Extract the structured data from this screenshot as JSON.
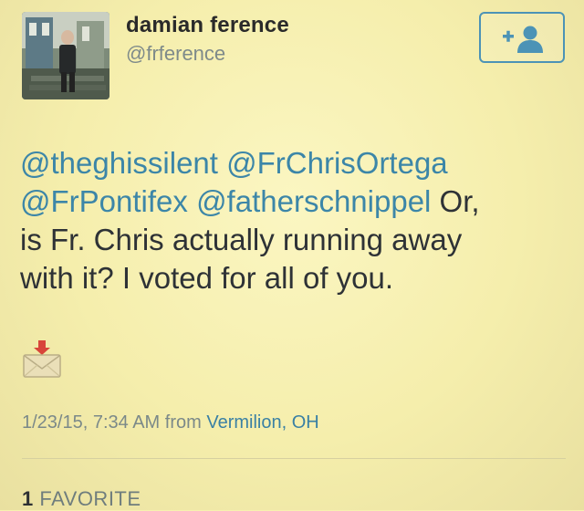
{
  "user": {
    "display_name": "damian ference",
    "handle": "@frference"
  },
  "follow_button": {
    "icon": "add-person-icon",
    "color": "#4c93b6"
  },
  "tweet": {
    "mentions": [
      "@theghissilent",
      "@FrChrisOrtega",
      "@FrPontifex",
      "@fatherschnippel"
    ],
    "text_line1_rest": " Or,",
    "text_line2": "is Fr. Chris actually running away",
    "text_line3": "with it? I voted for all of you.",
    "attachment_icon": "incoming-envelope-icon"
  },
  "meta": {
    "timestamp": "1/23/15, 7:34 AM",
    "from_word": "from",
    "location": "Vermilion, OH"
  },
  "favorites": {
    "count": "1",
    "label": "FAVORITE"
  },
  "colors": {
    "background": "#f7f1b0",
    "link": "#3c86a8",
    "text": "#2e3236",
    "muted": "#7b8989"
  }
}
